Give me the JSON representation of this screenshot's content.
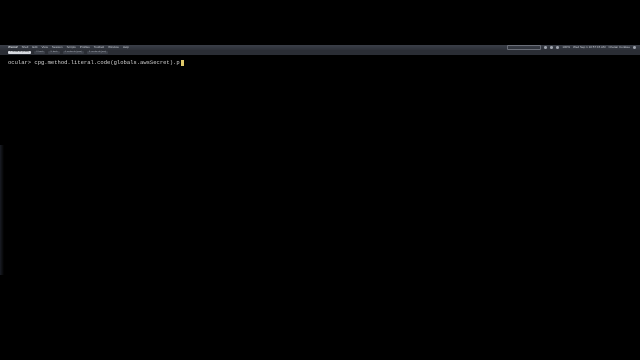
{
  "menubar": {
    "apple": "",
    "items": [
      "iTerm2",
      "Shell",
      "Edit",
      "View",
      "Session",
      "Scripts",
      "Profiles",
      "Toolbelt",
      "Window",
      "Help"
    ],
    "clock": "Wed Sep 1  10:57:15 AM",
    "user": "Chetan Conikee",
    "battery": "100%"
  },
  "tabs": [
    {
      "label": "1. ocular.sh (ocular)",
      "active": true
    },
    {
      "label": "2. bash",
      "active": false
    },
    {
      "label": "3. bash",
      "active": false
    },
    {
      "label": "4. ocular.sh (java)",
      "active": false
    },
    {
      "label": "5. ocular.sh (java)",
      "active": false
    }
  ],
  "terminal": {
    "prompt": "ocular>",
    "command": " cpg.method.literal.code(globals.awsSecret).p"
  }
}
